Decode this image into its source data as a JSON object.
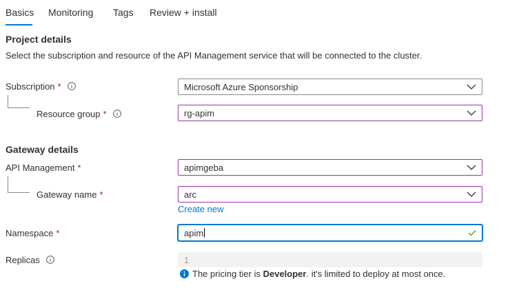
{
  "tabs": [
    {
      "label": "Basics"
    },
    {
      "label": "Monitoring"
    },
    {
      "label": "Tags"
    },
    {
      "label": "Review + install"
    }
  ],
  "project": {
    "title": "Project details",
    "description": "Select the subscription and resource of the API Management service that will be connected to the cluster."
  },
  "subscription": {
    "label": "Subscription",
    "required": "*",
    "value": "Microsoft Azure Sponsorship"
  },
  "resource_group": {
    "label": "Resource group",
    "required": "*",
    "value": "rg-apim"
  },
  "gateway": {
    "title": "Gateway details"
  },
  "api_management": {
    "label": "API Management",
    "required": "*",
    "value": "apimgeba"
  },
  "gateway_name": {
    "label": "Gateway name",
    "required": "*",
    "value": "arc",
    "create_new": "Create new"
  },
  "namespace": {
    "label": "Namespace",
    "required": "*",
    "value": "apim"
  },
  "replicas": {
    "label": "Replicas",
    "value": "1"
  },
  "note": {
    "prefix": "The pricing tier is ",
    "tier": "Developer",
    "suffix": ". it's limited to deploy at most once."
  },
  "colors": {
    "accent": "#0078d4",
    "required": "#a4262c",
    "highlight_border": "#9c2fae",
    "valid": "#57a300"
  }
}
